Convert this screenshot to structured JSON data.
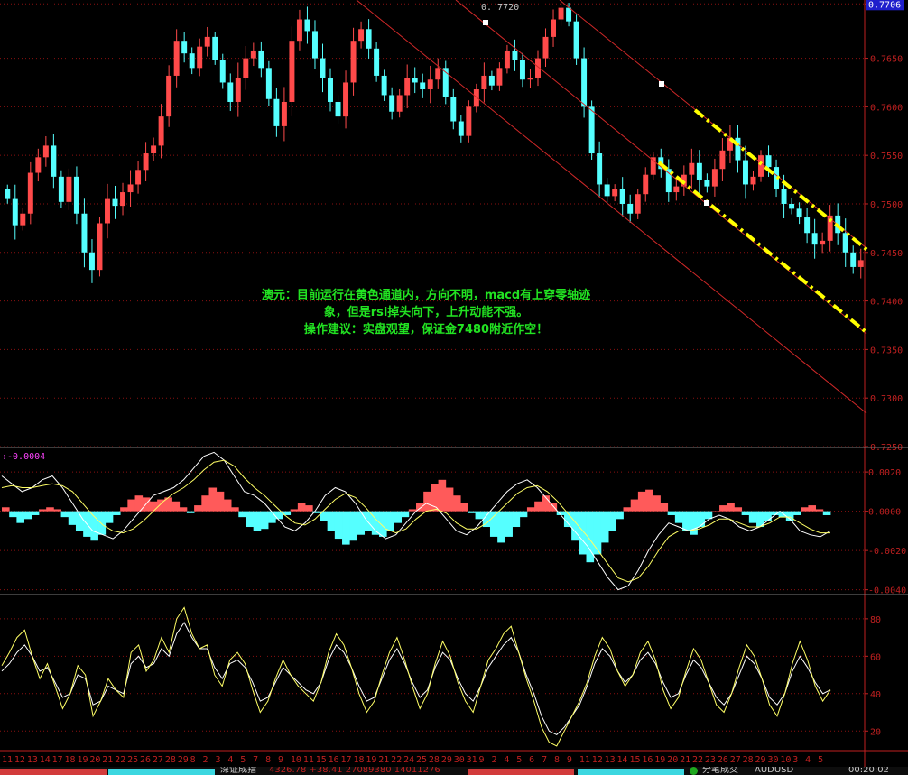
{
  "chart_data": [
    {
      "type": "candlestick",
      "title": "AUDUSD",
      "price_axis_ticks": [
        "0.7706",
        "0.7650",
        "0.7600",
        "0.7550",
        "0.7500",
        "0.7450",
        "0.7400",
        "0.7350",
        "0.7300",
        "0.7250"
      ],
      "price_axis_values": [
        0.7706,
        0.765,
        0.76,
        0.755,
        0.75,
        0.745,
        0.74,
        0.735,
        0.73,
        0.725
      ],
      "current_price_label": "0.7706",
      "high_marker_label": "0. 7720",
      "ylim": [
        0.725,
        0.771
      ],
      "close_series": [
        0.7505,
        0.7478,
        0.749,
        0.7532,
        0.7548,
        0.756,
        0.7528,
        0.7502,
        0.7528,
        0.749,
        0.745,
        0.7432,
        0.748,
        0.7505,
        0.7498,
        0.7512,
        0.752,
        0.7535,
        0.7552,
        0.756,
        0.759,
        0.7632,
        0.7668,
        0.7655,
        0.764,
        0.7662,
        0.7672,
        0.7648,
        0.7625,
        0.7605,
        0.763,
        0.765,
        0.7658,
        0.764,
        0.7608,
        0.758,
        0.7605,
        0.7668,
        0.769,
        0.7678,
        0.765,
        0.763,
        0.7605,
        0.759,
        0.7625,
        0.7668,
        0.768,
        0.766,
        0.7632,
        0.7612,
        0.7595,
        0.7612,
        0.763,
        0.7625,
        0.7618,
        0.7628,
        0.764,
        0.761,
        0.7585,
        0.757,
        0.76,
        0.7618,
        0.7632,
        0.7622,
        0.764,
        0.7658,
        0.7648,
        0.7628,
        0.763,
        0.765,
        0.7672,
        0.769,
        0.7702,
        0.7688,
        0.765,
        0.76,
        0.7552,
        0.752,
        0.7508,
        0.7515,
        0.75,
        0.749,
        0.751,
        0.753,
        0.7548,
        0.7536,
        0.7512,
        0.7518,
        0.753,
        0.7542,
        0.7525,
        0.7518,
        0.7536,
        0.7555,
        0.7568,
        0.7545,
        0.752,
        0.7528,
        0.755,
        0.7538,
        0.7515,
        0.75,
        0.7495,
        0.7486,
        0.747,
        0.7458,
        0.7462,
        0.7488,
        0.747,
        0.745,
        0.7435,
        0.7442
      ],
      "channel_lines": "two red regression channels; yellow dash-dot channel"
    },
    {
      "type": "line",
      "name": "MACD",
      "header_label": ":-0.0004",
      "ticks": [
        "0.0020",
        "0.0000",
        "-0.0020",
        "-0.0040"
      ],
      "tick_values": [
        0.002,
        0.0,
        -0.002,
        -0.004
      ],
      "ylim": [
        -0.0042,
        0.0032
      ],
      "histogram_note": "red above zero, cyan below zero",
      "histogram": [
        0.0002,
        -0.0003,
        -0.0006,
        -0.0004,
        -0.0002,
        0.0001,
        0.0002,
        0.0001,
        -0.0003,
        -0.0007,
        -0.001,
        -0.0013,
        -0.0015,
        -0.0012,
        -0.0006,
        -0.0002,
        0.0002,
        0.0006,
        0.0008,
        0.0007,
        0.0005,
        0.0006,
        0.0007,
        0.0005,
        0.0002,
        -0.0001,
        0.0003,
        0.0008,
        0.0012,
        0.001,
        0.0006,
        0.0002,
        -0.0003,
        -0.0008,
        -0.001,
        -0.0009,
        -0.0006,
        -0.0004,
        -0.0002,
        0.0001,
        0.0004,
        0.0003,
        -0.0001,
        -0.0005,
        -0.001,
        -0.0014,
        -0.0017,
        -0.0015,
        -0.0012,
        -0.001,
        -0.0012,
        -0.0013,
        -0.001,
        -0.0006,
        -0.0003,
        0.0001,
        0.0004,
        0.001,
        0.0014,
        0.0016,
        0.0012,
        0.0008,
        0.0004,
        -0.0001,
        -0.0004,
        -0.0008,
        -0.0013,
        -0.0016,
        -0.0013,
        -0.0008,
        -0.0003,
        0.0002,
        0.0005,
        0.0008,
        0.0004,
        -0.0002,
        -0.0008,
        -0.0015,
        -0.0022,
        -0.0026,
        -0.0022,
        -0.0016,
        -0.001,
        -0.0004,
        0.0002,
        0.0006,
        0.001,
        0.0011,
        0.0008,
        0.0004,
        -0.0002,
        -0.0006,
        -0.001,
        -0.0012,
        -0.0008,
        -0.0004,
        0.0,
        0.0003,
        0.0004,
        0.0002,
        -0.0002,
        -0.0006,
        -0.0008,
        -0.0005,
        -0.0002,
        -0.0003,
        -0.0005,
        -0.0002,
        0.0002,
        0.0003,
        0.0001,
        -0.0002
      ],
      "dif": [
        0.0018,
        0.0014,
        0.001,
        0.0012,
        0.0016,
        0.0018,
        0.0012,
        0.0004,
        -0.0004,
        -0.001,
        -0.0012,
        -0.0014,
        -0.001,
        -0.0004,
        0.0002,
        0.0008,
        0.001,
        0.0012,
        0.0016,
        0.0022,
        0.0028,
        0.003,
        0.0026,
        0.0018,
        0.001,
        0.0008,
        0.0004,
        -0.0002,
        -0.0008,
        -0.001,
        -0.0006,
        0.0,
        0.0008,
        0.0012,
        0.001,
        0.0004,
        -0.0004,
        -0.001,
        -0.0014,
        -0.0012,
        -0.0006,
        0.0,
        0.0004,
        0.0002,
        -0.0004,
        -0.001,
        -0.0012,
        -0.0008,
        -0.0002,
        0.0004,
        0.001,
        0.0014,
        0.0016,
        0.0012,
        0.0006,
        0.0,
        -0.0006,
        -0.0012,
        -0.0018,
        -0.0026,
        -0.0034,
        -0.004,
        -0.0038,
        -0.003,
        -0.002,
        -0.0012,
        -0.0006,
        -0.0008,
        -0.001,
        -0.0008,
        -0.0004,
        -0.0002,
        -0.0004,
        -0.0008,
        -0.001,
        -0.0008,
        -0.0004,
        0.0,
        -0.0004,
        -0.001,
        -0.0012,
        -0.0013,
        -0.001
      ],
      "dea": [
        0.0012,
        0.0013,
        0.0012,
        0.0012,
        0.0013,
        0.0014,
        0.0013,
        0.001,
        0.0004,
        -0.0002,
        -0.0007,
        -0.001,
        -0.0011,
        -0.0009,
        -0.0005,
        0.0,
        0.0005,
        0.0009,
        0.0012,
        0.0016,
        0.0021,
        0.0025,
        0.0026,
        0.0023,
        0.0017,
        0.0012,
        0.0008,
        0.0003,
        -0.0002,
        -0.0006,
        -0.0007,
        -0.0004,
        0.0001,
        0.0006,
        0.0009,
        0.0007,
        0.0002,
        -0.0004,
        -0.0009,
        -0.0011,
        -0.0009,
        -0.0004,
        0.0,
        0.0001,
        -0.0001,
        -0.0006,
        -0.0009,
        -0.0009,
        -0.0006,
        -0.0001,
        0.0004,
        0.0009,
        0.0012,
        0.0013,
        0.001,
        0.0005,
        -0.0001,
        -0.0007,
        -0.0013,
        -0.002,
        -0.0027,
        -0.0034,
        -0.0036,
        -0.0034,
        -0.0028,
        -0.002,
        -0.0013,
        -0.001,
        -0.001,
        -0.0009,
        -0.0007,
        -0.0004,
        -0.0004,
        -0.0006,
        -0.0008,
        -0.0008,
        -0.0006,
        -0.0003,
        -0.0003,
        -0.0006,
        -0.0009,
        -0.0011,
        -0.0011
      ]
    },
    {
      "type": "line",
      "name": "RSI",
      "ticks": [
        "80",
        "60",
        "40",
        "20"
      ],
      "tick_values": [
        80,
        60,
        40,
        20
      ],
      "ylim": [
        10,
        92
      ],
      "rsi_fast": [
        55,
        62,
        70,
        74,
        60,
        48,
        56,
        44,
        32,
        40,
        55,
        50,
        28,
        36,
        48,
        42,
        38,
        62,
        66,
        52,
        58,
        70,
        62,
        80,
        86,
        72,
        64,
        66,
        50,
        44,
        58,
        62,
        56,
        42,
        30,
        36,
        48,
        58,
        50,
        44,
        40,
        36,
        46,
        62,
        72,
        66,
        54,
        40,
        30,
        36,
        50,
        62,
        70,
        58,
        44,
        32,
        40,
        56,
        68,
        60,
        46,
        36,
        30,
        44,
        58,
        64,
        72,
        76,
        62,
        48,
        36,
        22,
        14,
        12,
        20,
        28,
        36,
        46,
        60,
        70,
        64,
        52,
        44,
        50,
        62,
        68,
        58,
        42,
        32,
        38,
        52,
        64,
        58,
        46,
        34,
        30,
        40,
        54,
        66,
        60,
        48,
        34,
        28,
        40,
        56,
        68,
        58,
        44,
        36,
        42
      ],
      "rsi_slow": [
        52,
        56,
        62,
        66,
        60,
        52,
        54,
        46,
        38,
        40,
        50,
        48,
        34,
        36,
        44,
        42,
        40,
        56,
        60,
        54,
        56,
        64,
        60,
        72,
        78,
        70,
        64,
        64,
        54,
        48,
        56,
        58,
        54,
        46,
        36,
        38,
        46,
        54,
        50,
        46,
        42,
        40,
        46,
        58,
        66,
        62,
        54,
        44,
        36,
        38,
        48,
        58,
        64,
        56,
        46,
        38,
        42,
        54,
        62,
        58,
        48,
        40,
        36,
        44,
        54,
        60,
        66,
        70,
        62,
        50,
        40,
        28,
        20,
        18,
        22,
        28,
        34,
        44,
        56,
        64,
        60,
        52,
        46,
        50,
        58,
        62,
        56,
        46,
        38,
        40,
        50,
        58,
        54,
        46,
        38,
        34,
        40,
        50,
        60,
        56,
        48,
        38,
        34,
        40,
        52,
        60,
        54,
        46,
        40,
        42
      ]
    }
  ],
  "annotation": {
    "line1": "澳元：目前运行在黄色通道内，方向不明，macd有上穿零轴迹",
    "line2": "象，但是rsi掉头向下，上升动能不强。",
    "line3": "操作建议：实盘观望，保证金7480附近作空！"
  },
  "date_axis": {
    "labels": [
      "11",
      "12",
      "13",
      "14",
      "17",
      "18",
      "19",
      "20",
      "21",
      "22",
      "25",
      "26",
      "27",
      "28",
      "29",
      "8",
      "2",
      "3",
      "4",
      "5",
      "7",
      "8",
      "9",
      "10",
      "11",
      "15",
      "16",
      "17",
      "18",
      "19",
      "21",
      "22",
      "24",
      "25",
      "28",
      "29",
      "30",
      "31",
      "9",
      "2",
      "4",
      "5",
      "6",
      "7",
      "8",
      "9",
      "11",
      "12",
      "13",
      "14",
      "15",
      "16",
      "19",
      "20",
      "21",
      "22",
      "23",
      "26",
      "27",
      "28",
      "29",
      "30",
      "10",
      "3",
      "4",
      "5"
    ]
  },
  "status_bar": {
    "index_label": "深证成指",
    "index_values": "4326.78 +38.41 27089380 14011276",
    "market_label": "分笔成交",
    "symbol": "AUDUSD",
    "time": "00:20:02"
  },
  "colors": {
    "background": "#000000",
    "axis_red": "#c02020",
    "grid_red": "#8a1010",
    "bull_candle": "#ff4a4a",
    "bear_candle": "#55ffff",
    "channel_yellow": "#ffff00",
    "annotation_green": "#22e322",
    "macd_pos": "#ff5a5a",
    "macd_neg": "#55ffff",
    "line_white": "#ffffff",
    "line_yellow": "#ffff66",
    "current_price_bg": "#1f1fcc"
  }
}
